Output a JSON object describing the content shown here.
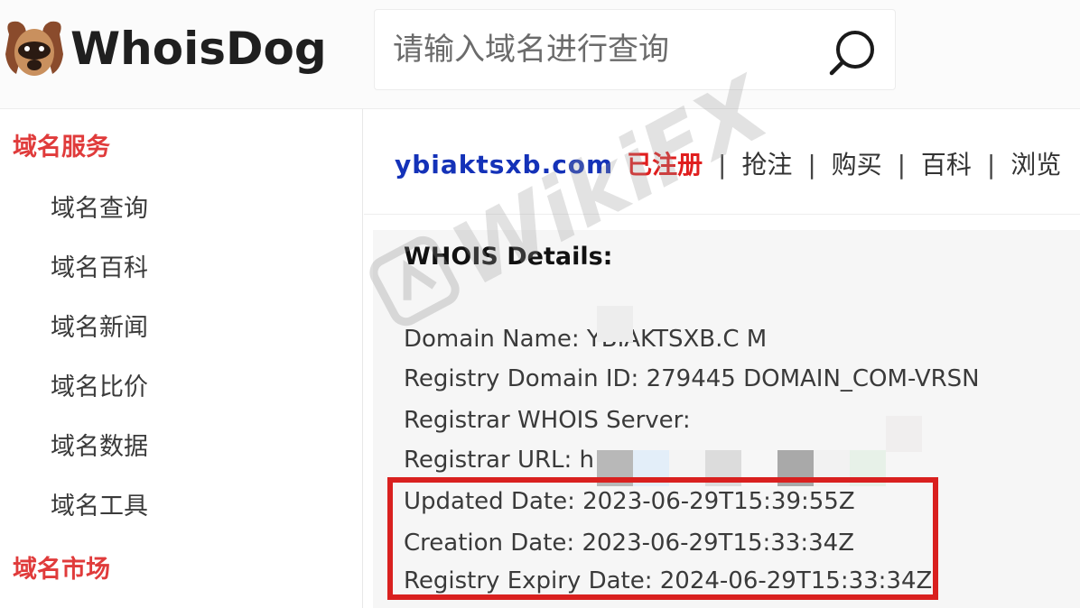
{
  "header": {
    "logo_text": "WhoisDog",
    "search_placeholder": "请输入域名进行查询"
  },
  "sidebar": {
    "domain_services_title": "域名服务",
    "items": [
      {
        "label": "域名查询"
      },
      {
        "label": "域名百科"
      },
      {
        "label": "域名新闻"
      },
      {
        "label": "域名比价"
      },
      {
        "label": "域名数据"
      },
      {
        "label": "域名工具"
      }
    ],
    "domain_market_title": "域名市场"
  },
  "result": {
    "domain": "ybiaktsxb.com",
    "status": "已注册",
    "actions": [
      {
        "label": "抢注"
      },
      {
        "label": "购买"
      },
      {
        "label": "百科"
      },
      {
        "label": "浏览"
      }
    ]
  },
  "whois": {
    "title": "WHOIS Details:",
    "fields": [
      {
        "text": "Domain Name: YBIAKTSXB.C     M"
      },
      {
        "text": "Registry Domain ID: 279445            DOMAIN_COM-VRSN"
      },
      {
        "text": "Registrar WHOIS Server:"
      },
      {
        "text": "Registrar URL: h"
      },
      {
        "text": "Updated Date: 2023-06-29T15:39:55Z"
      },
      {
        "text": "Creation Date: 2023-06-29T15:33:34Z"
      },
      {
        "text": "Registry Expiry Date: 2024-06-29T15:33:34Z"
      }
    ]
  },
  "watermark": {
    "text": "WikiFX"
  },
  "colors": {
    "accent_red": "#e03b3b",
    "domain_blue": "#1432b8",
    "highlight_border": "#d9201f"
  }
}
